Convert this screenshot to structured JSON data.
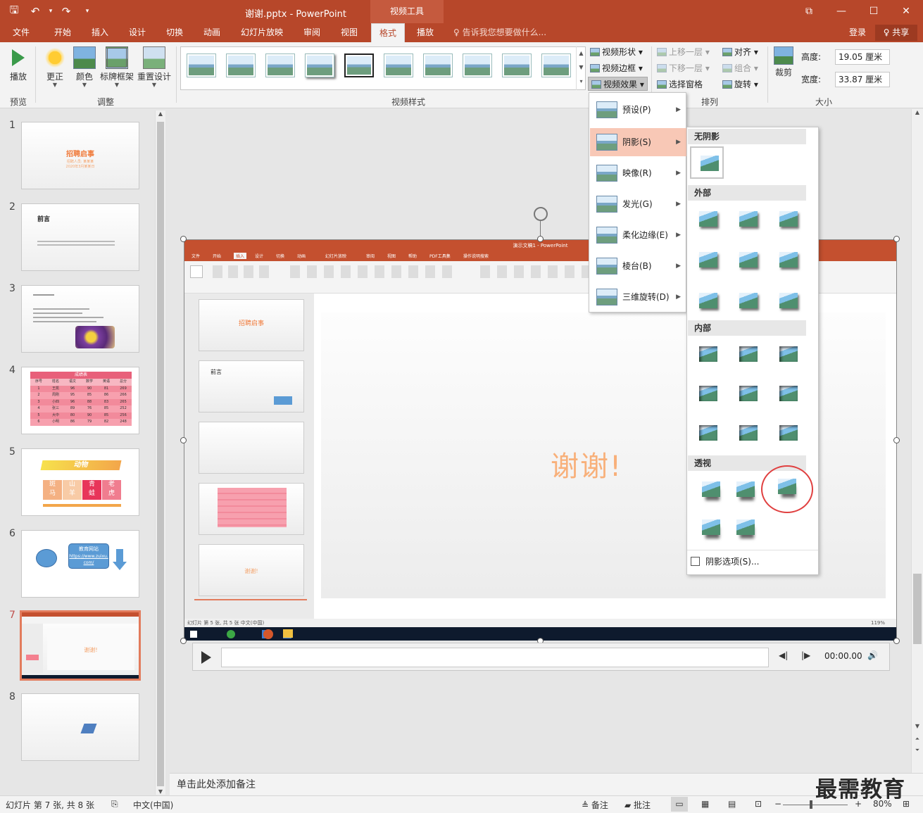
{
  "titlebar": {
    "document_title": "谢谢.pptx - PowerPoint",
    "context_group": "视频工具",
    "qat": {
      "save": "🖫",
      "undo": "↶",
      "undo_drop": "▾",
      "redo": "↷",
      "customize": "▾"
    },
    "window_controls": {
      "restore_ribbon": "⧉",
      "minimize": "—",
      "maximize": "☐",
      "close": "✕"
    }
  },
  "tabs": {
    "items": [
      "文件",
      "开始",
      "插入",
      "设计",
      "切换",
      "动画",
      "幻灯片放映",
      "审阅",
      "视图",
      "格式",
      "播放"
    ],
    "active": "格式",
    "tell_me": "♀ 告诉我您想要做什么...",
    "login": "登录",
    "share": "♀ 共享"
  },
  "ribbon": {
    "preview": {
      "play": "播放",
      "group": "预览"
    },
    "adjust": {
      "corrections": "更正",
      "color": "颜色",
      "poster_frame": "标牌框架",
      "reset_design": "重置设计",
      "group": "调整"
    },
    "styles": {
      "group": "视频样式",
      "shape": "视频形状 ▾",
      "border": "视频边框 ▾",
      "effects": "视频效果 ▾"
    },
    "arrange": {
      "bring_forward": "上移一层 ▾",
      "send_backward": "下移一层 ▾",
      "selection_pane": "选择窗格",
      "align": "对齐 ▾",
      "group": "组合 ▾",
      "rotate": "旋转 ▾",
      "group_label": "排列"
    },
    "size": {
      "crop": "裁剪",
      "height_label": "高度:",
      "height_value": "19.05 厘米",
      "width_label": "宽度:",
      "width_value": "33.87 厘米",
      "group": "大小"
    }
  },
  "slides": [
    {
      "num": "1",
      "title": "招聘启事",
      "line1": "招聘人员: 某某某",
      "line2": "2020年3月某某日"
    },
    {
      "num": "2",
      "title": "前言"
    },
    {
      "num": "3"
    },
    {
      "num": "4",
      "title": "成绩表",
      "headers": [
        "序号",
        "姓名",
        "语文",
        "数学",
        "英语",
        "总分"
      ],
      "rows": [
        [
          "1",
          "王凯",
          "96",
          "90",
          "81",
          "269"
        ],
        [
          "2",
          "周刚",
          "95",
          "85",
          "86",
          "266"
        ],
        [
          "3",
          "小四",
          "96",
          "88",
          "83",
          "265"
        ],
        [
          "4",
          "张三",
          "89",
          "76",
          "85",
          "252"
        ],
        [
          "5",
          "大中",
          "80",
          "90",
          "85",
          "256"
        ],
        [
          "6",
          "小明",
          "86",
          "79",
          "82",
          "248"
        ]
      ]
    },
    {
      "num": "5",
      "title": "动物",
      "tiles": [
        [
          "斑",
          "马"
        ],
        [
          "山",
          "羊"
        ],
        [
          "青",
          "蛙"
        ],
        [
          "老",
          "虎"
        ]
      ]
    },
    {
      "num": "6",
      "box_title": "教育网站",
      "box_link": "https://www.zuixu.com/"
    },
    {
      "num": "7",
      "text": "谢谢!"
    },
    {
      "num": "8"
    }
  ],
  "video": {
    "mini_window_title": "演示文稿1 - PowerPoint",
    "mini_tabs": [
      "文件",
      "开始",
      "插入",
      "设计",
      "切换",
      "动画",
      "幻灯片放映",
      "审阅",
      "视图",
      "帮助",
      "PDF工具集",
      "操作说明搜索"
    ],
    "mini_slide_text": "谢谢!",
    "mini_thumb_titles": [
      "招聘启事",
      "前言",
      "",
      "",
      "谢谢!"
    ],
    "mini_status": "幻灯片 第 5 张, 共 5 张    中文(中国)",
    "mini_zoom": "119%"
  },
  "mediabar": {
    "time": "00:00.00",
    "back": "◀|",
    "forward": "|▶",
    "volume": "🔊"
  },
  "effects_menu": {
    "items": [
      {
        "label": "预设(P)"
      },
      {
        "label": "阴影(S)"
      },
      {
        "label": "映像(R)"
      },
      {
        "label": "发光(G)"
      },
      {
        "label": "柔化边缘(E)"
      },
      {
        "label": "棱台(B)"
      },
      {
        "label": "三维旋转(D)"
      }
    ],
    "highlighted": "阴影(S)"
  },
  "shadow_menu": {
    "no_shadow": "无阴影",
    "outer": "外部",
    "inner": "内部",
    "perspective": "透视",
    "options": "阴影选项(S)..."
  },
  "notes": {
    "placeholder": "单击此处添加备注"
  },
  "statusbar": {
    "slide_info": "幻灯片 第 7 张, 共 8 张",
    "language": "中文(中国)",
    "notes": "≜ 备注",
    "comments": "▰ 批注",
    "zoom": "80%",
    "zoom_minus": "−",
    "zoom_plus": "+"
  },
  "watermark": "最需教育",
  "colors": {
    "accent": "#b7472a",
    "menu_highlight": "#f8c8b6",
    "annotation_circle": "#e04040"
  }
}
